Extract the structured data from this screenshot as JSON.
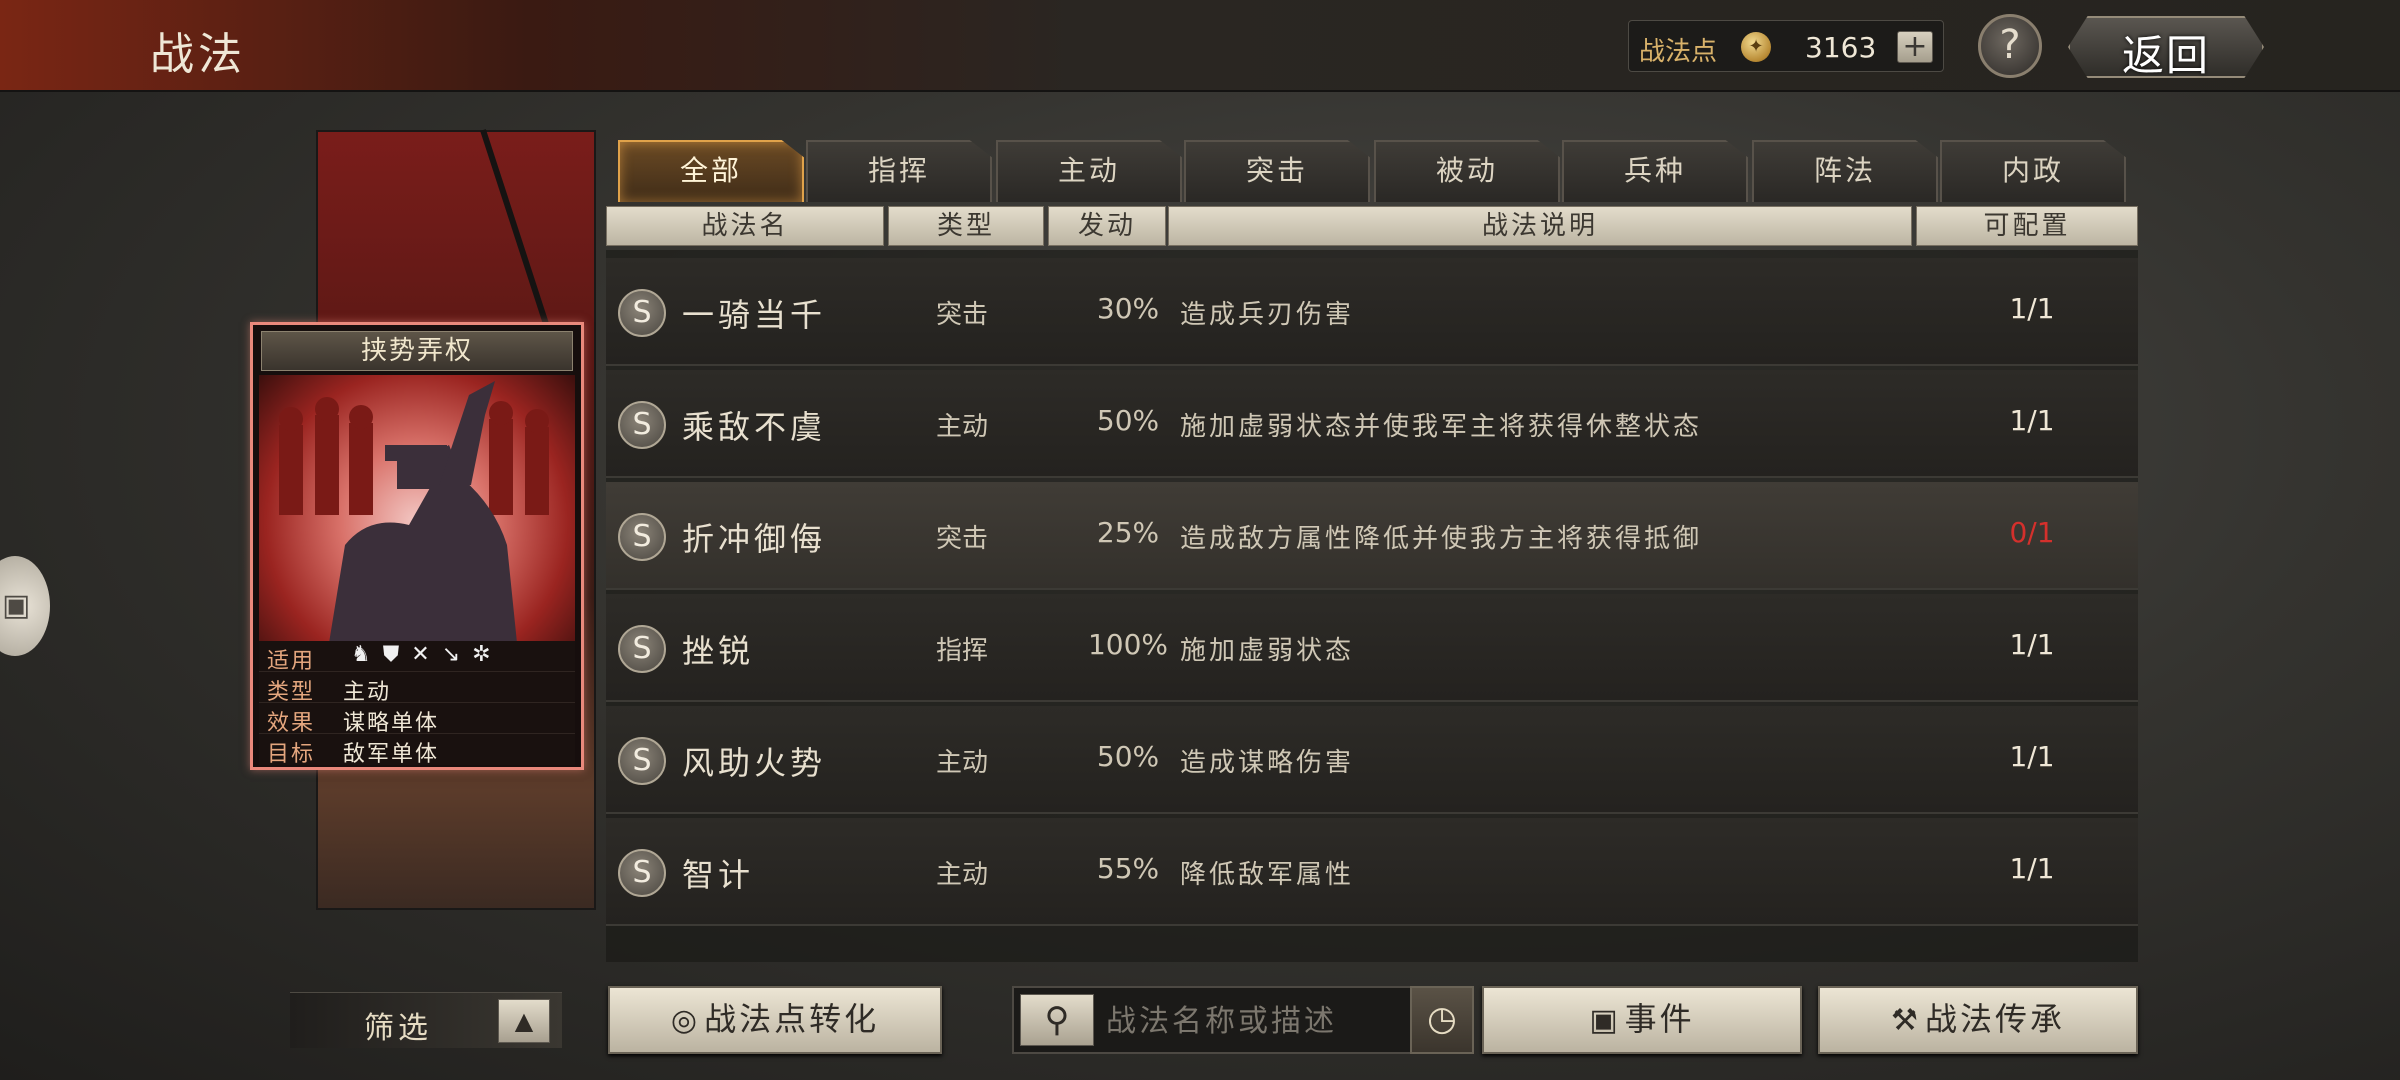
{
  "header": {
    "title": "战法",
    "points_label": "战法点",
    "points_value": "3163",
    "add_symbol": "+",
    "help_symbol": "?",
    "back_label": "返回"
  },
  "card": {
    "name": "挟势弄权",
    "stats": [
      {
        "key": "适用",
        "value": ""
      },
      {
        "key": "类型",
        "value": "主动"
      },
      {
        "key": "效果",
        "value": "谋略单体"
      },
      {
        "key": "目标",
        "value": "敌军单体"
      }
    ],
    "troop_icons": [
      "cavalry-icon",
      "shield-icon",
      "bow-icon",
      "spear-icon",
      "wheel-icon"
    ]
  },
  "tabs": [
    {
      "label": "全部",
      "active": true
    },
    {
      "label": "指挥",
      "active": false
    },
    {
      "label": "主动",
      "active": false
    },
    {
      "label": "突击",
      "active": false
    },
    {
      "label": "被动",
      "active": false
    },
    {
      "label": "兵种",
      "active": false
    },
    {
      "label": "阵法",
      "active": false
    },
    {
      "label": "内政",
      "active": false
    }
  ],
  "columns": {
    "name": "战法名",
    "type": "类型",
    "rate": "发动",
    "desc": "战法说明",
    "count": "可配置"
  },
  "rows": [
    {
      "grade": "S",
      "name": "一骑当千",
      "type": "突击",
      "rate": "30%",
      "desc": "造成兵刃伤害",
      "count": "1/1"
    },
    {
      "grade": "S",
      "name": "乘敌不虞",
      "type": "主动",
      "rate": "50%",
      "desc": "施加虚弱状态并使我军主将获得休整状态",
      "count": "1/1"
    },
    {
      "grade": "S",
      "name": "折冲御侮",
      "type": "突击",
      "rate": "25%",
      "desc": "造成敌方属性降低并使我方主将获得抵御",
      "count": "0/1"
    },
    {
      "grade": "S",
      "name": "挫锐",
      "type": "指挥",
      "rate": "100%",
      "desc": "施加虚弱状态",
      "count": "1/1"
    },
    {
      "grade": "S",
      "name": "风助火势",
      "type": "主动",
      "rate": "50%",
      "desc": "造成谋略伤害",
      "count": "1/1"
    },
    {
      "grade": "S",
      "name": "智计",
      "type": "主动",
      "rate": "55%",
      "desc": "降低敌军属性",
      "count": "1/1"
    }
  ],
  "bottom": {
    "filter_label": "筛选",
    "convert_label": "战法点转化",
    "search_placeholder": "战法名称或描述",
    "event_label": "事件",
    "inherit_label": "战法传承"
  },
  "colors": {
    "accent_gold": "#e0a24a",
    "card_border": "#e9897c",
    "zero_count": "#d4302c"
  }
}
